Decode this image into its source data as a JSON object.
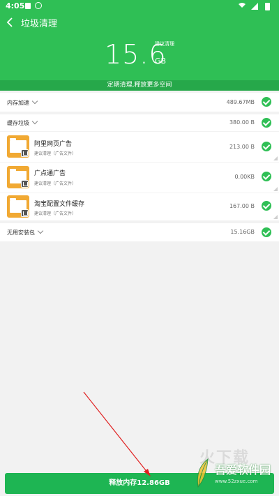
{
  "status": {
    "time": "4:05"
  },
  "header": {
    "title": "垃圾清理",
    "size_value": "15.6",
    "size_unit": "GB",
    "suggest_tag": "建议清理",
    "banner": "定期清理,释放更多空间"
  },
  "sections": [
    {
      "label": "内存加速",
      "value": "489.67MB"
    },
    {
      "label": "缓存垃圾",
      "value": "380.00 B"
    },
    {
      "label": "无用安装包",
      "value": "15.16GB"
    }
  ],
  "cache_items": [
    {
      "name": "阿里网页广告",
      "sub": "建议清理（广告文件）",
      "size": "213.00 B"
    },
    {
      "name": "广点通广告",
      "sub": "建议清理（广告文件）",
      "size": "0.00KB"
    },
    {
      "name": "淘宝配置文件缓存",
      "sub": "建议清理（广告文件）",
      "size": "167.00 B"
    }
  ],
  "free_button": {
    "label": "释放内存12.86GB"
  },
  "watermark": {
    "brand": "吾爱软件园",
    "url": "www.52zxue.com",
    "faint": "火下载"
  },
  "colors": {
    "primary_green": "#2fbf55",
    "banner_green": "#26a84a",
    "button_green": "#1eb553",
    "folder_orange": "#f1a933",
    "annotation_arrow": "#e02020"
  },
  "icons": [
    "back-arrow-icon",
    "chevron-down-icon",
    "check-circle-icon",
    "folder-icon",
    "trash-icon"
  ]
}
